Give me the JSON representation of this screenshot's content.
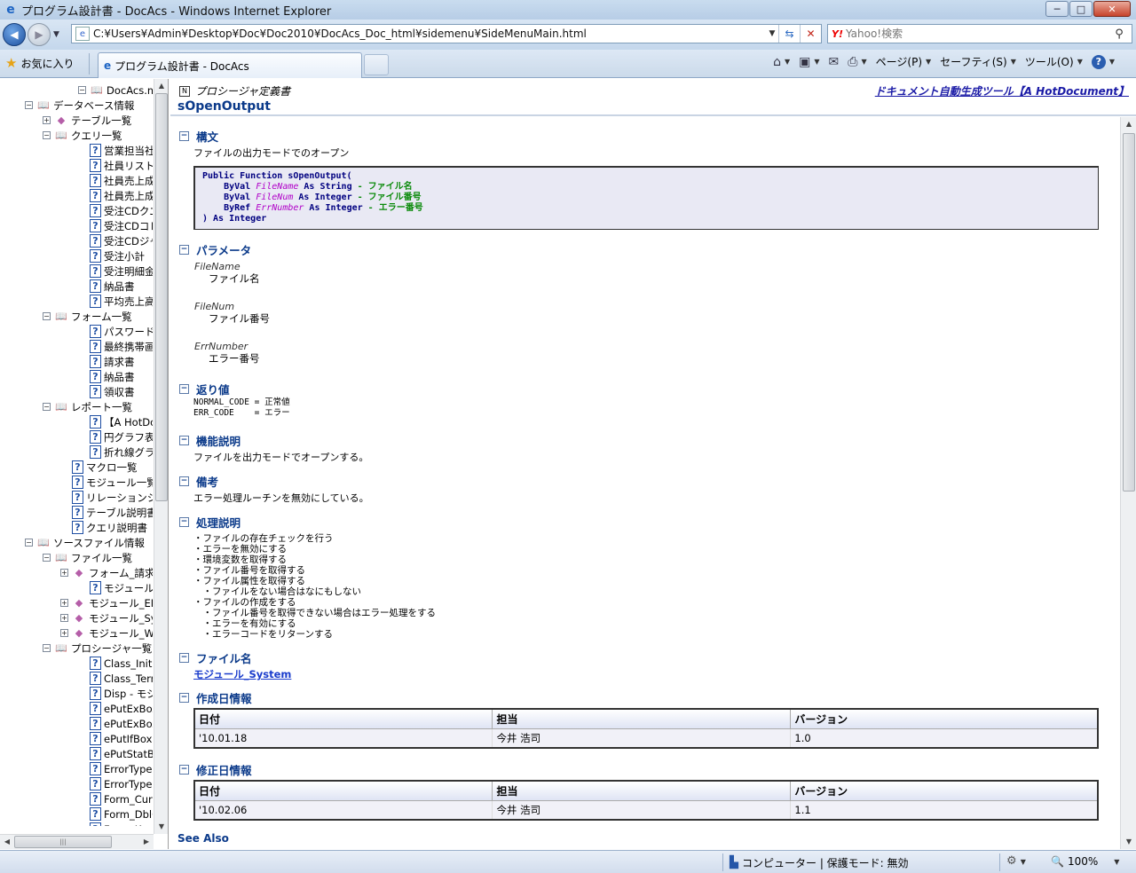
{
  "window": {
    "title": "プログラム設計書 - DocAcs - Windows Internet Explorer",
    "min": "─",
    "max": "□",
    "close": "✕"
  },
  "address": {
    "url": "C:¥Users¥Admin¥Desktop¥Doc¥Doc2010¥DocAcs_Doc_html¥sidemenu¥SideMenuMain.html",
    "search_placeholder": "Yahoo!検索",
    "search_logo": "Y!"
  },
  "tabs": {
    "favorites": "お気に入り",
    "active_tab": "プログラム設計書 - DocAcs"
  },
  "commandbar": {
    "page": "ページ(P)",
    "safety": "セーフティ(S)",
    "tools": "ツール(O)"
  },
  "tree": {
    "items": [
      {
        "label": "DocAcs.mdb",
        "icon": "book-icon",
        "pm": "-"
      },
      {
        "label": "データベース情報",
        "icon": "book-icon",
        "pm": "-"
      },
      {
        "label": "テーブル一覧",
        "icon": "table-icon",
        "pm": "+"
      },
      {
        "label": "クエリ一覧",
        "icon": "book-icon",
        "pm": "-"
      },
      {
        "label": "営業担当社員",
        "icon": "help-icon",
        "pm": ""
      },
      {
        "label": "社員リスト",
        "icon": "help-icon",
        "pm": ""
      },
      {
        "label": "社員売上成績",
        "icon": "help-icon",
        "pm": ""
      },
      {
        "label": "社員売上成績",
        "icon": "help-icon",
        "pm": ""
      },
      {
        "label": "受注CDクエリー",
        "icon": "help-icon",
        "pm": ""
      },
      {
        "label": "受注CDコレクト",
        "icon": "help-icon",
        "pm": ""
      },
      {
        "label": "受注CDジャンル",
        "icon": "help-icon",
        "pm": ""
      },
      {
        "label": "受注小計",
        "icon": "help-icon",
        "pm": ""
      },
      {
        "label": "受注明細金額",
        "icon": "help-icon",
        "pm": ""
      },
      {
        "label": "納品書",
        "icon": "help-icon",
        "pm": ""
      },
      {
        "label": "平均売上高",
        "icon": "help-icon",
        "pm": ""
      },
      {
        "label": "フォーム一覧",
        "icon": "book-icon",
        "pm": "-"
      },
      {
        "label": "パスワード",
        "icon": "help-icon",
        "pm": ""
      },
      {
        "label": "最終携帯画面",
        "icon": "help-icon",
        "pm": ""
      },
      {
        "label": "請求書",
        "icon": "help-icon",
        "pm": ""
      },
      {
        "label": "納品書",
        "icon": "help-icon",
        "pm": ""
      },
      {
        "label": "領収書",
        "icon": "help-icon",
        "pm": ""
      },
      {
        "label": "レポート一覧",
        "icon": "book-icon",
        "pm": "-"
      },
      {
        "label": "【A HotDocument",
        "icon": "help-icon",
        "pm": ""
      },
      {
        "label": "円グラフ表示",
        "icon": "help-icon",
        "pm": ""
      },
      {
        "label": "折れ線グラフ",
        "icon": "help-icon",
        "pm": ""
      },
      {
        "label": "マクロ一覧",
        "icon": "help-icon",
        "pm": ""
      },
      {
        "label": "モジュール一覧",
        "icon": "help-icon",
        "pm": ""
      },
      {
        "label": "リレーションシップ定義",
        "icon": "help-icon",
        "pm": ""
      },
      {
        "label": "テーブル説明書",
        "icon": "help-icon",
        "pm": ""
      },
      {
        "label": "クエリ説明書",
        "icon": "help-icon",
        "pm": ""
      },
      {
        "label": "ソースファイル情報",
        "icon": "book-icon",
        "pm": "-"
      },
      {
        "label": "ファイル一覧",
        "icon": "book-icon",
        "pm": "-"
      },
      {
        "label": "フォーム_請求書",
        "icon": "table-icon",
        "pm": "+"
      },
      {
        "label": "モジュール_DocSys",
        "icon": "help-icon",
        "pm": ""
      },
      {
        "label": "モジュール_EMessage",
        "icon": "table-icon",
        "pm": "+"
      },
      {
        "label": "モジュール_System",
        "icon": "table-icon",
        "pm": "+"
      },
      {
        "label": "モジュール_WCE",
        "icon": "table-icon",
        "pm": "+"
      },
      {
        "label": "プロシージャ一覧",
        "icon": "book-icon",
        "pm": "-"
      },
      {
        "label": "Class_Initialize",
        "icon": "help-icon",
        "pm": ""
      },
      {
        "label": "Class_Terminate",
        "icon": "help-icon",
        "pm": ""
      },
      {
        "label": "Disp - モジュール",
        "icon": "help-icon",
        "pm": ""
      },
      {
        "label": "ePutExBoxOk",
        "icon": "help-icon",
        "pm": ""
      },
      {
        "label": "ePutExBoxOk",
        "icon": "help-icon",
        "pm": ""
      },
      {
        "label": "ePutIfBoxOK",
        "icon": "help-icon",
        "pm": ""
      },
      {
        "label": "ePutStatBar",
        "icon": "help-icon",
        "pm": ""
      },
      {
        "label": "ErrorType - モ",
        "icon": "help-icon",
        "pm": ""
      },
      {
        "label": "ErrorType - モ",
        "icon": "help-icon",
        "pm": ""
      },
      {
        "label": "Form_Current",
        "icon": "help-icon",
        "pm": ""
      },
      {
        "label": "Form_DblClick",
        "icon": "help-icon",
        "pm": ""
      },
      {
        "label": "Form_KeyDown",
        "icon": "help-icon",
        "pm": ""
      }
    ]
  },
  "doc": {
    "doc_type": "プロシージャ定義書",
    "tool_link": "ドキュメント自動生成ツール【A HotDocument】",
    "title": "sOpenOutput",
    "sections": {
      "syntax": "構文",
      "params": "パラメータ",
      "returns": "返り値",
      "function": "機能説明",
      "notes": "備考",
      "process": "処理説明",
      "filename": "ファイル名",
      "created": "作成日情報",
      "modified": "修正日情報"
    },
    "syntax_desc": "ファイルの出力モードでのオープン",
    "code": {
      "line1": "Public Function sOpenOutput(",
      "l2_kw": "    ByVal ",
      "l2_pn": "FileName",
      "l2_type": " As String",
      "l2_cm": " - ファイル名",
      "l3_kw": "    ByVal ",
      "l3_pn": "FileNum",
      "l3_type": " As Integer",
      "l3_cm": " - ファイル番号",
      "l4_kw": "    ByRef ",
      "l4_pn": "ErrNumber",
      "l4_type": " As Integer",
      "l4_cm": " - エラー番号",
      "line5": ") As Integer"
    },
    "params": [
      {
        "name": "FileName",
        "desc": "ファイル名"
      },
      {
        "name": "FileNum",
        "desc": "ファイル番号"
      },
      {
        "name": "ErrNumber",
        "desc": "エラー番号"
      }
    ],
    "returns": [
      "NORMAL_CODE = 正常値",
      "ERR_CODE    = エラー"
    ],
    "function_desc": "ファイルを出力モードでオープンする。",
    "notes_desc": "エラー処理ルーチンを無効にしている。",
    "process": [
      "・ファイルの存在チェックを行う",
      "・エラーを無効にする",
      "・環境変数を取得する",
      "・ファイル番号を取得する",
      "・ファイル属性を取得する",
      "　・ファイルをない場合はなにもしない",
      "・ファイルの作成をする",
      "　・ファイル番号を取得できない場合はエラー処理をする",
      "　・エラーを有効にする",
      "　・エラーコードをリターンする"
    ],
    "file_link": "モジュール_System",
    "table_headers": {
      "date": "日付",
      "person": "担当",
      "version": "バージョン"
    },
    "created_row": {
      "date": "'10.01.18",
      "person": "今井 浩司",
      "version": "1.0"
    },
    "modified_row": {
      "date": "'10.02.06",
      "person": "今井 浩司",
      "version": "1.1"
    },
    "see_also": "See Also"
  },
  "status": {
    "zone": "コンピューター | 保護モード: 無効",
    "zoom": "100%"
  },
  "colors": {
    "heading": "#0b3a8a",
    "link": "#1a3ccc",
    "code_bg": "#e9e9f4",
    "param_purple": "#b000c8",
    "comment_green": "#0a8a0a"
  }
}
